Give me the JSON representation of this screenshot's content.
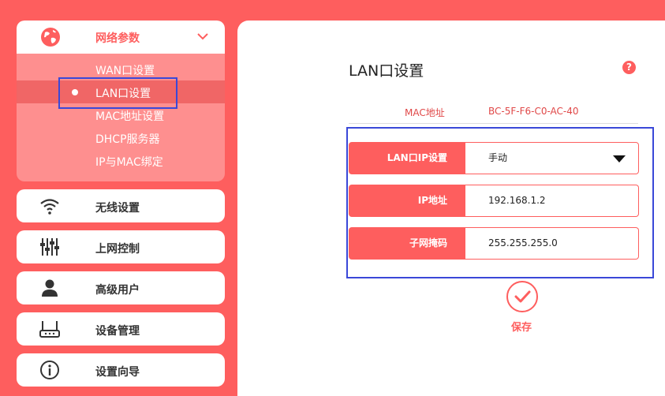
{
  "sidebar": {
    "group": {
      "label": "网络参数",
      "icon": "globe-icon",
      "items": [
        {
          "label": "WAN口设置"
        },
        {
          "label": "LAN口设置",
          "active": true
        },
        {
          "label": "MAC地址设置"
        },
        {
          "label": "DHCP服务器"
        },
        {
          "label": "IP与MAC绑定"
        }
      ]
    },
    "buttons": [
      {
        "label": "无线设置",
        "icon": "wifi-icon"
      },
      {
        "label": "上网控制",
        "icon": "sliders-icon"
      },
      {
        "label": "高级用户",
        "icon": "user-icon"
      },
      {
        "label": "设备管理",
        "icon": "router-icon"
      },
      {
        "label": "设置向导",
        "icon": "info-icon"
      }
    ]
  },
  "main": {
    "title": "LAN口设置",
    "help": "?",
    "mac": {
      "label": "MAC地址",
      "value": "BC-5F-F6-C0-AC-40"
    },
    "fields": [
      {
        "label": "LAN口IP设置",
        "value": "手动"
      },
      {
        "label": "IP地址",
        "value": "192.168.1.2"
      },
      {
        "label": "子网掩码",
        "value": "255.255.255.0"
      }
    ],
    "save_label": "保存"
  },
  "colors": {
    "accent": "#fe5e5e",
    "highlight": "#3a48d8"
  }
}
